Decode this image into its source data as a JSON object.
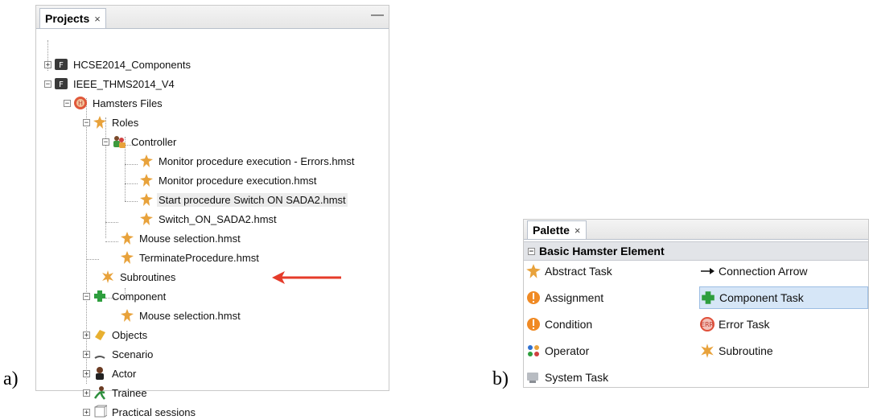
{
  "figure_labels": {
    "a": "a)",
    "b": "b)"
  },
  "projects": {
    "tab_label": "Projects",
    "tab_close": "×",
    "minimize": "—",
    "tree": [
      {
        "label": "HCSE2014_Components",
        "toggle": "+",
        "icon": "project-icon"
      },
      {
        "label": "IEEE_THMS2014_V4",
        "toggle": "−",
        "icon": "project-icon"
      },
      {
        "label": "Hamsters Files",
        "toggle": "−",
        "icon": "hamsters-icon"
      },
      {
        "label": "Roles",
        "toggle": "−",
        "icon": "task-icon"
      },
      {
        "label": "Controller",
        "toggle": "−",
        "icon": "controller-icon"
      },
      {
        "label": "Monitor procedure execution - Errors.hmst",
        "icon": "task-icon"
      },
      {
        "label": "Monitor procedure execution.hmst",
        "icon": "task-icon"
      },
      {
        "label": "Start procedure Switch ON SADA2.hmst",
        "icon": "task-icon",
        "selected": true
      },
      {
        "label": "Switch_ON_SADA2.hmst",
        "icon": "task-icon"
      },
      {
        "label": "Mouse selection.hmst",
        "icon": "task-icon"
      },
      {
        "label": "TerminateProcedure.hmst",
        "icon": "task-icon"
      },
      {
        "label": "Subroutines",
        "icon": "subroutine-icon"
      },
      {
        "label": "Component",
        "toggle": "−",
        "icon": "component-icon"
      },
      {
        "label": "Mouse selection.hmst",
        "icon": "task-icon"
      },
      {
        "label": "Objects",
        "toggle": "+",
        "icon": "objects-icon"
      },
      {
        "label": "Scenario",
        "toggle": "+",
        "icon": "scenario-icon"
      },
      {
        "label": "Actor",
        "toggle": "+",
        "icon": "actor-icon"
      },
      {
        "label": "Trainee",
        "toggle": "+",
        "icon": "trainee-icon"
      },
      {
        "label": "Practical sessions",
        "toggle": "+",
        "icon": "sessions-icon"
      }
    ]
  },
  "palette": {
    "tab_label": "Palette",
    "tab_close": "×",
    "section_label": "Basic Hamster Element",
    "section_toggle": "−",
    "items": [
      {
        "label": "Abstract Task",
        "icon": "abstract-task-icon"
      },
      {
        "label": "Connection Arrow",
        "icon": "arrow-icon"
      },
      {
        "label": "Assignment",
        "icon": "assignment-icon"
      },
      {
        "label": "Component Task",
        "icon": "component-icon",
        "selected": true
      },
      {
        "label": "Condition",
        "icon": "condition-icon"
      },
      {
        "label": "Error Task",
        "icon": "error-task-icon"
      },
      {
        "label": "Operator",
        "icon": "operator-icon"
      },
      {
        "label": "Subroutine",
        "icon": "subroutine-icon"
      },
      {
        "label": "System Task",
        "icon": "system-task-icon"
      }
    ]
  },
  "colors": {
    "selection": "#d6e6f7",
    "arrow": "#e53b2a",
    "hamster_orange": "#e8a23b"
  }
}
